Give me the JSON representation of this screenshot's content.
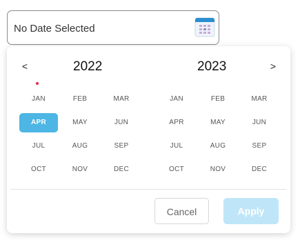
{
  "input": {
    "value": "No Date Selected",
    "icon": "calendar-icon"
  },
  "picker": {
    "prev_label": "<",
    "next_label": ">",
    "left_year": "2022",
    "right_year": "2023",
    "selected_month": "APR 2022",
    "today_marker": "JAN 2022",
    "left_months": [
      "JAN",
      "FEB",
      "MAR",
      "APR",
      "MAY",
      "JUN",
      "JUL",
      "AUG",
      "SEP",
      "OCT",
      "NOV",
      "DEC"
    ],
    "right_months": [
      "JAN",
      "FEB",
      "MAR",
      "APR",
      "MAY",
      "JUN",
      "JUL",
      "AUG",
      "SEP",
      "OCT",
      "NOV",
      "DEC"
    ]
  },
  "actions": {
    "cancel_label": "Cancel",
    "apply_label": "Apply",
    "apply_enabled": false
  },
  "colors": {
    "accent": "#4db6e4",
    "apply_disabled_bg": "#bfe6f8",
    "today_dot": "#e0264a",
    "icon_header": "#2a8fd0"
  }
}
